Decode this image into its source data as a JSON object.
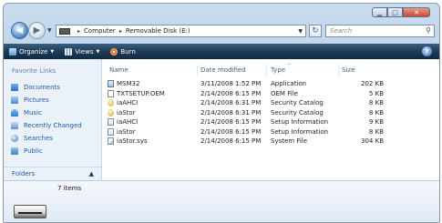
{
  "address": {
    "segments": [
      "Computer",
      "Removable Disk (E:)"
    ],
    "search_placeholder": "Search"
  },
  "toolbar": {
    "organize": "Organize",
    "views": "Views",
    "burn": "Burn",
    "help": "?"
  },
  "nav": {
    "favorites_title": "Favorite Links",
    "items": [
      {
        "label": "Documents",
        "icon": "documents-icon"
      },
      {
        "label": "Pictures",
        "icon": "pictures-icon"
      },
      {
        "label": "Music",
        "icon": "music-icon"
      },
      {
        "label": "Recently Changed",
        "icon": "recently-changed-icon"
      },
      {
        "label": "Searches",
        "icon": "searches-icon"
      },
      {
        "label": "Public",
        "icon": "public-icon"
      }
    ],
    "folders_label": "Folders"
  },
  "columns": {
    "name": "Name",
    "date": "Date modified",
    "type": "Type",
    "size": "Size"
  },
  "files": [
    {
      "name": "MSM32",
      "date": "3/11/2008 1:52 PM",
      "type": "Application",
      "size": "202 KB",
      "icon": "app"
    },
    {
      "name": "TXTSETUP.OEM",
      "date": "2/14/2008 6:15 PM",
      "type": "OEM File",
      "size": "5 KB",
      "icon": "oem"
    },
    {
      "name": "iaAHCI",
      "date": "2/14/2008 6:31 PM",
      "type": "Security Catalog",
      "size": "8 KB",
      "icon": "cat"
    },
    {
      "name": "iaStor",
      "date": "2/14/2008 6:31 PM",
      "type": "Security Catalog",
      "size": "8 KB",
      "icon": "cat"
    },
    {
      "name": "iaAHCI",
      "date": "2/14/2008 6:15 PM",
      "type": "Setup Information",
      "size": "9 KB",
      "icon": "inf"
    },
    {
      "name": "iaStor",
      "date": "2/14/2008 6:15 PM",
      "type": "Setup Information",
      "size": "8 KB",
      "icon": "inf"
    },
    {
      "name": "iaStor.sys",
      "date": "2/14/2008 6:15 PM",
      "type": "System File",
      "size": "304 KB",
      "icon": "sys"
    }
  ],
  "details": {
    "count": "7 items"
  }
}
